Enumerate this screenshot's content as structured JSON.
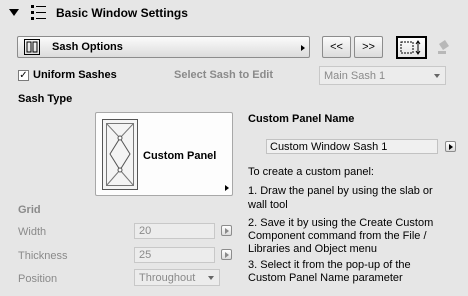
{
  "header": {
    "title": "Basic Window Settings"
  },
  "toolbar": {
    "sash_options_label": "Sash Options",
    "prev_label": "<<",
    "next_label": ">>"
  },
  "uniform_sashes": {
    "label": "Uniform Sashes",
    "checked": true,
    "check_glyph": "✓"
  },
  "select_sash": {
    "label": "Select Sash to Edit",
    "value": "Main Sash 1"
  },
  "sash_type": {
    "heading": "Sash Type",
    "preview_label": "Custom Panel"
  },
  "custom_panel": {
    "heading": "Custom Panel Name",
    "value": "Custom Window Sash 1"
  },
  "instructions": {
    "intro": "To create a custom panel:",
    "step1_line1": "1. Draw the panel by using the slab or",
    "step1_line2": "wall tool",
    "step2_line1": "2. Save it by using the Create Custom",
    "step2_line2": "Component command from the File /",
    "step2_line3": "Libraries and Object menu",
    "step3_line1": "3. Select it from the pop-up of the",
    "step3_line2": "Custom Panel Name parameter"
  },
  "grid": {
    "heading": "Grid",
    "width_label": "Width",
    "width_value": "20",
    "thickness_label": "Thickness",
    "thickness_value": "25",
    "position_label": "Position",
    "position_value": "Throughout"
  },
  "colors": {
    "background": "#e6e6e6",
    "disabled_text": "#8a8a8a"
  }
}
